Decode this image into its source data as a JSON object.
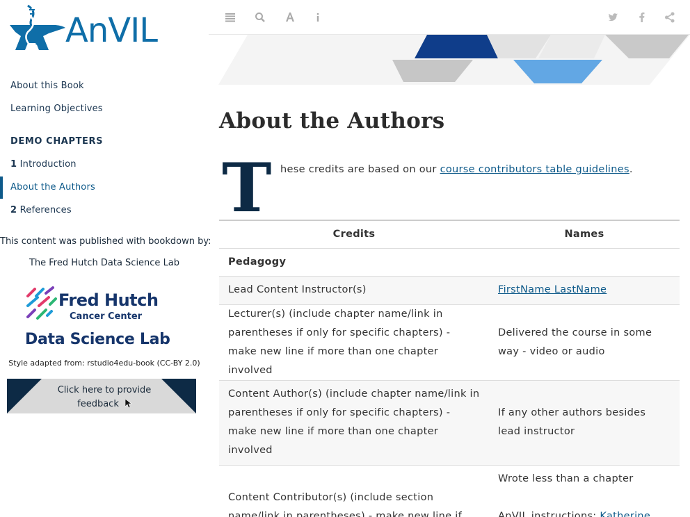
{
  "sidebar": {
    "logo_text": "AnVIL",
    "nav": [
      {
        "label": "About this Book"
      },
      {
        "label": "Learning Objectives"
      },
      {
        "label": "DEMO CHAPTERS"
      },
      {
        "num": "1",
        "label": "Introduction"
      },
      {
        "label": "About the Authors",
        "active": true
      },
      {
        "num": "2",
        "label": "References"
      }
    ],
    "published_by": "This content was published with bookdown by:",
    "lab_name": "The Fred Hutch Data Science Lab",
    "fh_logo": {
      "line1": "Fred Hutch",
      "line2": "Cancer Center",
      "line3": "Data Science Lab"
    },
    "style_adapted": "Style adapted from: rstudio4edu-book (CC-BY 2.0)",
    "feedback": {
      "line1": "Click here to provide",
      "line2": "feedback"
    }
  },
  "toolbar": {
    "left_icons": [
      "menu-icon",
      "search-icon",
      "font-icon",
      "info-icon"
    ],
    "right_icons": [
      "twitter-icon",
      "facebook-icon",
      "share-icon"
    ]
  },
  "main": {
    "title": "About the Authors",
    "dropcap": "T",
    "intro_text": "hese credits are based on our ",
    "intro_link": "course contributors table guidelines",
    "intro_end": ".",
    "table": {
      "headers": [
        "Credits",
        "Names"
      ],
      "section": "Pedagogy",
      "rows": [
        {
          "credit": "Lead Content Instructor(s)",
          "name_link": "FirstName LastName"
        },
        {
          "credit": "Lecturer(s) (include chapter name/link in parentheses if only for specific chapters) - make new line if more than one chapter involved",
          "name": "Delivered the course in some way - video or audio"
        },
        {
          "credit": "Content Author(s) (include chapter name/link in parentheses if only for specific chapters) - make new line if more than one chapter involved",
          "name": "If any other authors besides lead instructor"
        },
        {
          "credit": "Content Contributor(s) (include section name/link in parentheses) - make new line if",
          "name": "Wrote less than a chapter",
          "name2": "AnVIL instructions: ",
          "name2_link": "Katherine"
        }
      ]
    }
  },
  "colors": {
    "brand_blue": "#0f6ea8",
    "navy": "#0d2a45",
    "link": "#0e5a8a"
  }
}
